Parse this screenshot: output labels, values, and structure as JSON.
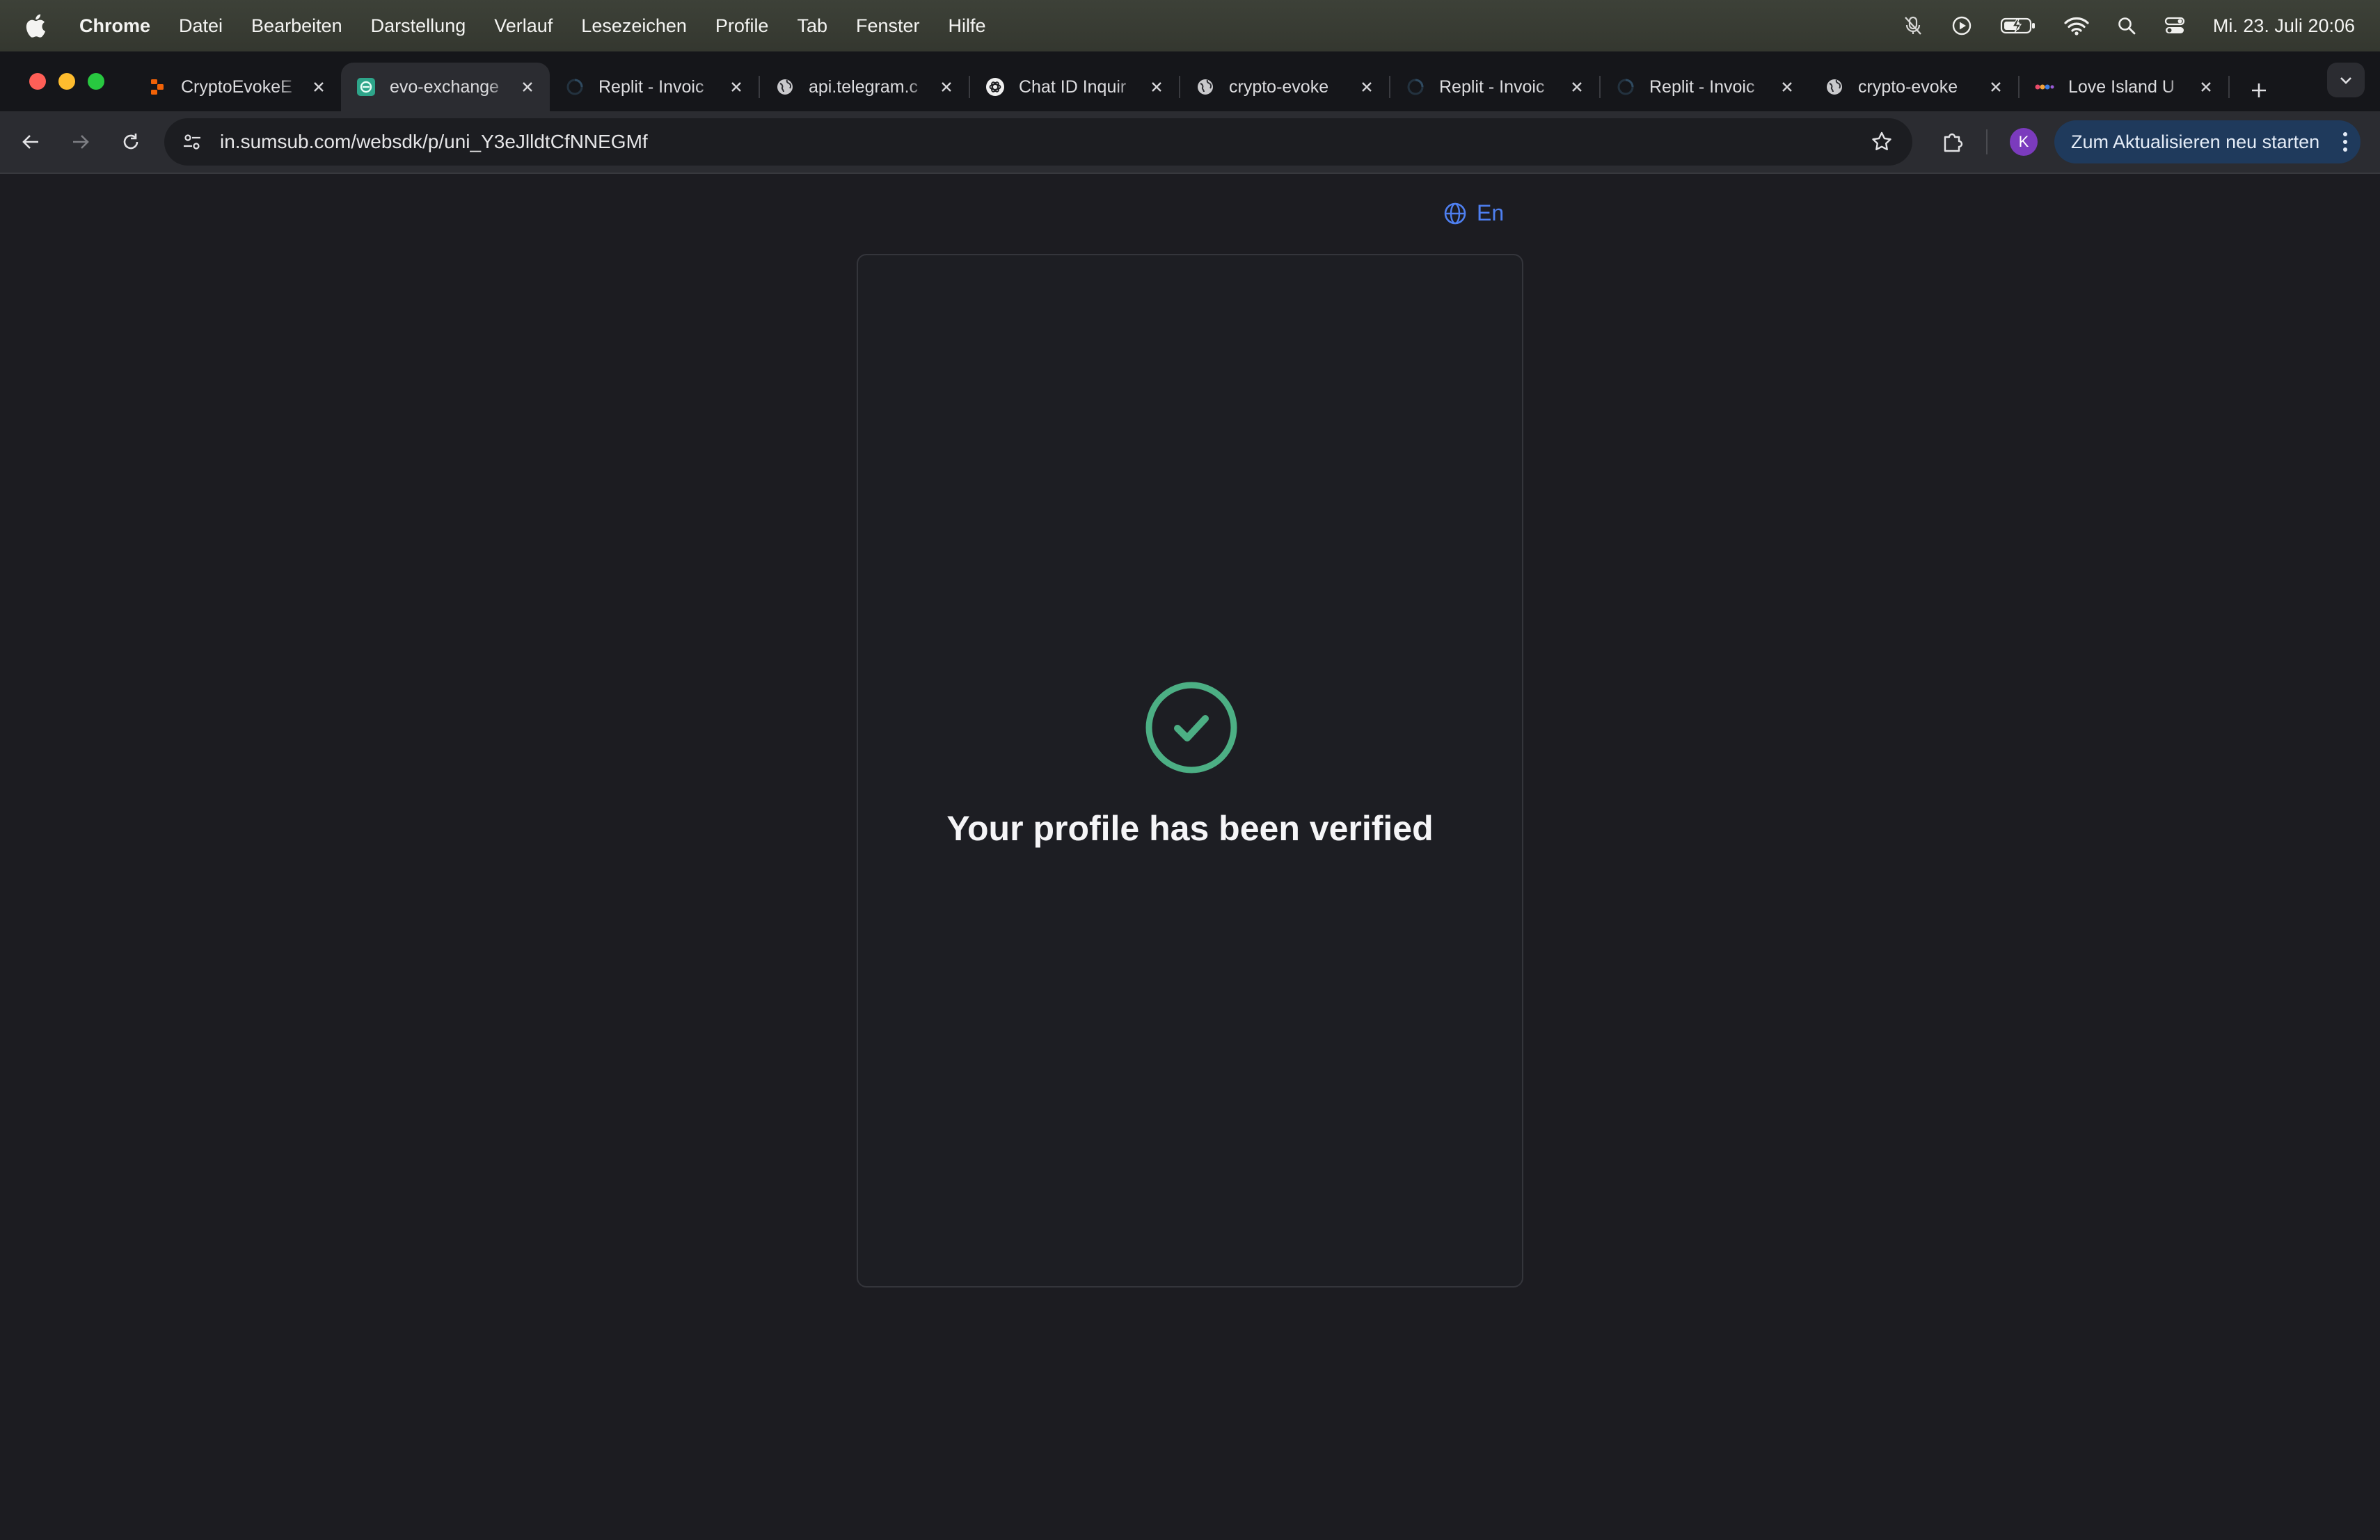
{
  "menubar": {
    "app": "Chrome",
    "items": [
      "Datei",
      "Bearbeiten",
      "Darstellung",
      "Verlauf",
      "Lesezeichen",
      "Profile",
      "Tab",
      "Fenster",
      "Hilfe"
    ],
    "clock": "Mi. 23. Juli  20:06",
    "status_icons": [
      "mic-off-icon",
      "play-icon",
      "battery-charging-icon",
      "wifi-icon",
      "spotlight-search-icon",
      "control-center-icon"
    ]
  },
  "tabs": [
    {
      "title": "CryptoEvokeE",
      "favicon": "replit-icon",
      "active": false
    },
    {
      "title": "evo-exchange",
      "favicon": "evo-icon",
      "active": true
    },
    {
      "title": "Replit - Invoic",
      "favicon": "loading-icon",
      "active": false
    },
    {
      "title": "api.telegram.c",
      "favicon": "globe-icon",
      "active": false
    },
    {
      "title": "Chat ID Inquir",
      "favicon": "openai-icon",
      "active": false
    },
    {
      "title": "crypto-evoke",
      "favicon": "globe-icon",
      "active": false
    },
    {
      "title": "Replit - Invoic",
      "favicon": "loading-icon",
      "active": false
    },
    {
      "title": "Replit - Invoic",
      "favicon": "loading-icon",
      "active": false
    },
    {
      "title": "crypto-evoke",
      "favicon": "globe-icon",
      "active": false
    },
    {
      "title": "Love Island U",
      "favicon": "itv-icon",
      "active": false
    }
  ],
  "toolbar": {
    "url": "in.sumsub.com/websdk/p/uni_Y3eJlldtCfNNEGMf",
    "avatar_letter": "K",
    "update_label": "Zum Aktualisieren neu starten"
  },
  "page": {
    "language": "En",
    "status_message": "Your profile has been verified"
  },
  "colors": {
    "accent_blue": "#4e7ff0",
    "success_green": "#4caf84",
    "background": "#1c1c21"
  }
}
